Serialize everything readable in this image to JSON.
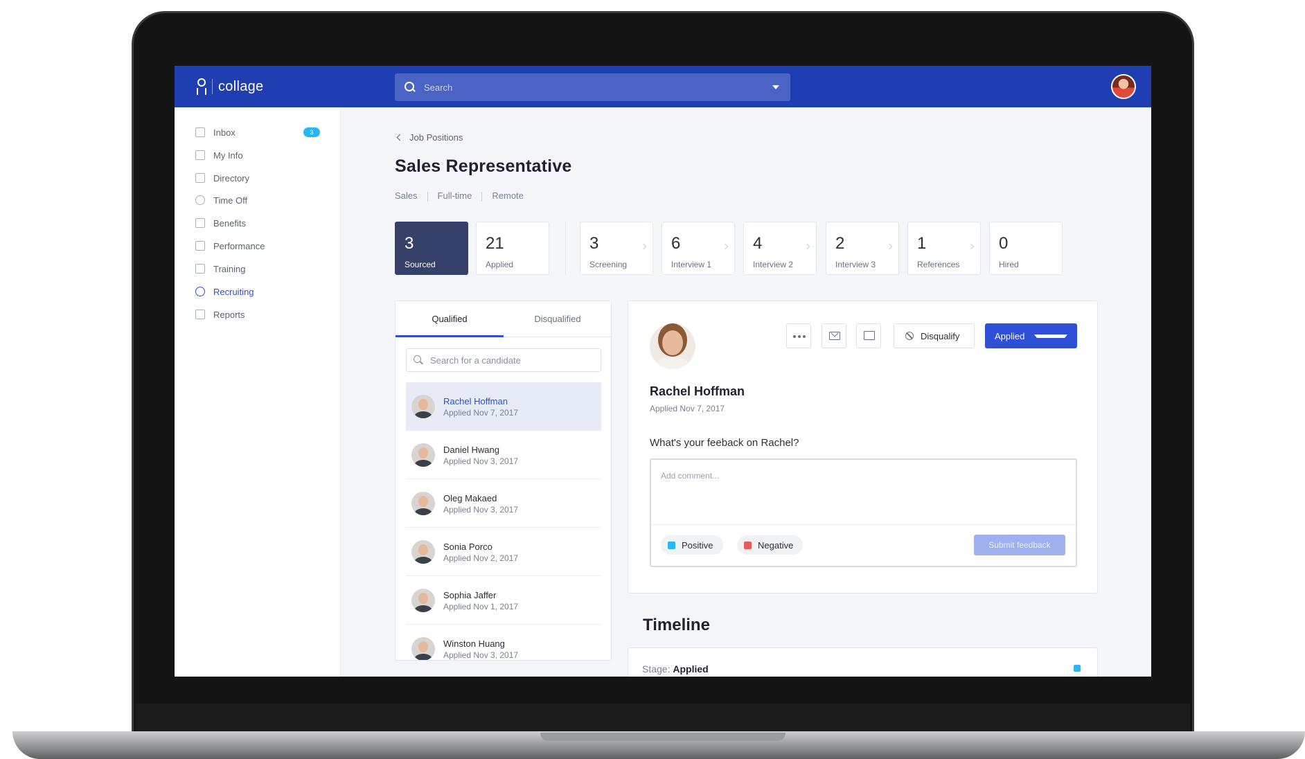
{
  "app": {
    "name": "collage"
  },
  "search": {
    "placeholder": "Search"
  },
  "sidebar": {
    "items": [
      {
        "label": "Inbox",
        "badge": "3"
      },
      {
        "label": "My Info"
      },
      {
        "label": "Directory"
      },
      {
        "label": "Time Off"
      },
      {
        "label": "Benefits"
      },
      {
        "label": "Performance"
      },
      {
        "label": "Training"
      },
      {
        "label": "Recruiting",
        "active": true
      },
      {
        "label": "Reports"
      }
    ]
  },
  "breadcrumb": {
    "back_label": "Job Positions"
  },
  "job": {
    "title": "Sales Representative",
    "tags": [
      "Sales",
      "Full-time",
      "Remote"
    ]
  },
  "stages": [
    {
      "count": "3",
      "label": "Sourced",
      "active": true
    },
    {
      "count": "21",
      "label": "Applied"
    },
    {
      "count": "3",
      "label": "Screening"
    },
    {
      "count": "6",
      "label": "Interview 1"
    },
    {
      "count": "4",
      "label": "Interview 2"
    },
    {
      "count": "2",
      "label": "Interview 3"
    },
    {
      "count": "1",
      "label": "References"
    },
    {
      "count": "0",
      "label": "Hired"
    }
  ],
  "candidates": {
    "tabs": [
      "Qualified",
      "Disqualified"
    ],
    "search_placeholder": "Search for a candidate",
    "list": [
      {
        "name": "Rachel Hoffman",
        "date": "Applied Nov 7, 2017"
      },
      {
        "name": "Daniel Hwang",
        "date": "Applied Nov 3, 2017"
      },
      {
        "name": "Oleg Makaed",
        "date": "Applied Nov 3, 2017"
      },
      {
        "name": "Sonia Porco",
        "date": "Applied Nov 2, 2017"
      },
      {
        "name": "Sophia Jaffer",
        "date": "Applied Nov 1, 2017"
      },
      {
        "name": "Winston Huang",
        "date": "Applied Nov 3, 2017"
      }
    ]
  },
  "detail": {
    "name": "Rachel Hoffman",
    "date": "Applied Nov 7, 2017",
    "disqualify_label": "Disqualify",
    "stage_value": "Applied",
    "feedback_question": "What's your feeback on Rachel?",
    "comment_placeholder": "Add comment...",
    "positive_label": "Positive",
    "negative_label": "Negative",
    "submit_label": "Submit feedback"
  },
  "timeline": {
    "title": "Timeline",
    "stage_prefix": "Stage:",
    "stage_value": "Applied"
  },
  "colors": {
    "brand": "#1f3eb1",
    "accent": "#2f50d6",
    "active_stage": "#36416a"
  }
}
